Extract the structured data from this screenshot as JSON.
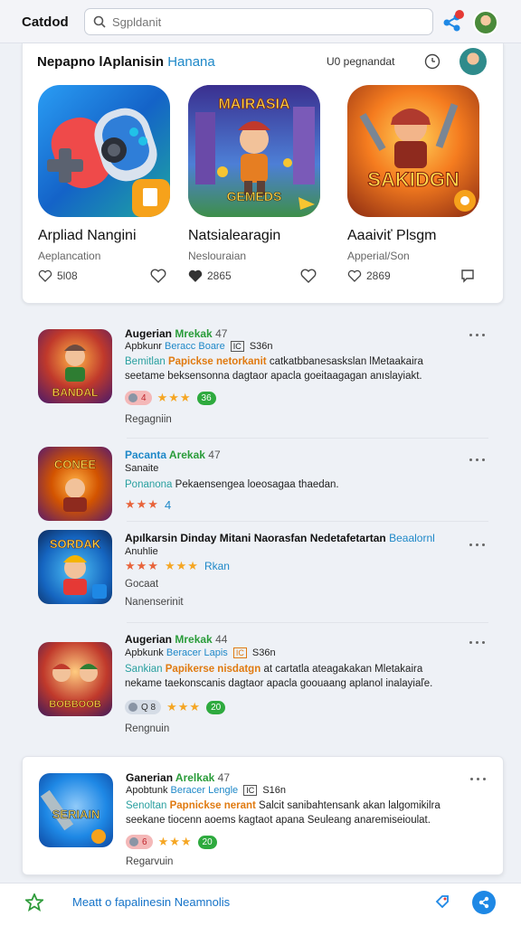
{
  "topbar": {
    "title": "Catdod",
    "search_placeholder": "Sgpldanit"
  },
  "featured": {
    "title": "Nepapno lAplanisin",
    "title_accent": "Hanana",
    "subtitle": "U0 pegnandat",
    "apps": [
      {
        "name": "Arpliad Nangini",
        "category": "Aeplancation",
        "count": "5l08",
        "icon": "gamepad-icon"
      },
      {
        "name": "Natsialearagin",
        "category": "Neslouraian",
        "count": "2865",
        "icon": "hero-game-icon",
        "icon_text_top": "MAIRASIA",
        "icon_text_bottom": "GEMEDS"
      },
      {
        "name": "Aaaiviť Plsgm",
        "category": "Apperial/Son",
        "count": "2869",
        "icon": "warrior-game-icon",
        "icon_text": "SAKIDGN"
      }
    ]
  },
  "list": [
    {
      "title": "Augerian",
      "title_tag": "Mrekak",
      "title_num": "47",
      "meta_a": "Apbkunr",
      "meta_b": "Beracc",
      "meta_c": "Boare",
      "meta_box": "IC",
      "meta_d": "S36n",
      "desc1_lead": "Bemitlan",
      "desc1_hl": "Papickse netorkanit",
      "desc1_rest": "catkatbbanesaskslan lMetaakaira",
      "desc2": "seetame beksensonna dagtaor apacla goeitaagagan anıslayiakt.",
      "pill": "4",
      "stars": "★★★",
      "badge": "36",
      "footer": "Regagniin",
      "icon_text": "BANDAL"
    },
    {
      "title": "Pacanta",
      "title_tag": "Arekak",
      "title_num": "47",
      "meta_a": "Sanaite",
      "desc1_lead": "Ponanona",
      "desc1_rest": "Pekaensengea loeosagaa thaedan.",
      "stars": "★★★",
      "extra": "4",
      "icon_text": "CONEE"
    },
    {
      "title": "Apılkarsin Dinday Mitani Naorasfan Nedetafetartan",
      "title_tag": "Beaalornl",
      "meta_a": "Anuhlie",
      "stars": "★★★",
      "badge_text": "Rkan",
      "footer1": "Gocaat",
      "footer2": "Nanenserinit",
      "icon_text": "SORDAK"
    },
    {
      "title": "Augerian",
      "title_tag": "Mrekak",
      "title_num": "44",
      "meta_a": "Apbkunk",
      "meta_b": "Beracer",
      "meta_c": "Lapis",
      "meta_box": "IC",
      "meta_d": "S36n",
      "desc1_lead": "Sankian",
      "desc1_hl": "Papikerse nisdatgn",
      "desc1_rest": "at cartatla ateagakakan Mletakaira",
      "desc2": "nekame taekonscanis dagtaor apacla goouaang aplanol inalayiaľe.",
      "pill": "Q 8",
      "stars": "★★★",
      "badge": "20",
      "footer": "Rengnuin",
      "icon_text": "BOBBOOB"
    },
    {
      "title": "Ganerian",
      "title_tag": "Arelkak",
      "title_num": "47",
      "meta_a": "Apobtunk",
      "meta_b": "Beracer",
      "meta_c": "Lengle",
      "meta_box": "IC",
      "meta_d": "S16n",
      "desc1_lead": "Senoltan",
      "desc1_hl": "Papnickse nerant",
      "desc1_rest": "Salcit sanibahtensank akan lalgomikilra",
      "desc2": "seekane tiocenn aoems kagtaot apana Seuleang anaremiseioulat.",
      "pill": "6",
      "stars": "★★★",
      "badge": "20",
      "footer": "Regarvuin",
      "icon_text": "SERIAIN"
    }
  ],
  "bottombar": {
    "text": "Meatt o fapalinesin Neamnolis"
  }
}
